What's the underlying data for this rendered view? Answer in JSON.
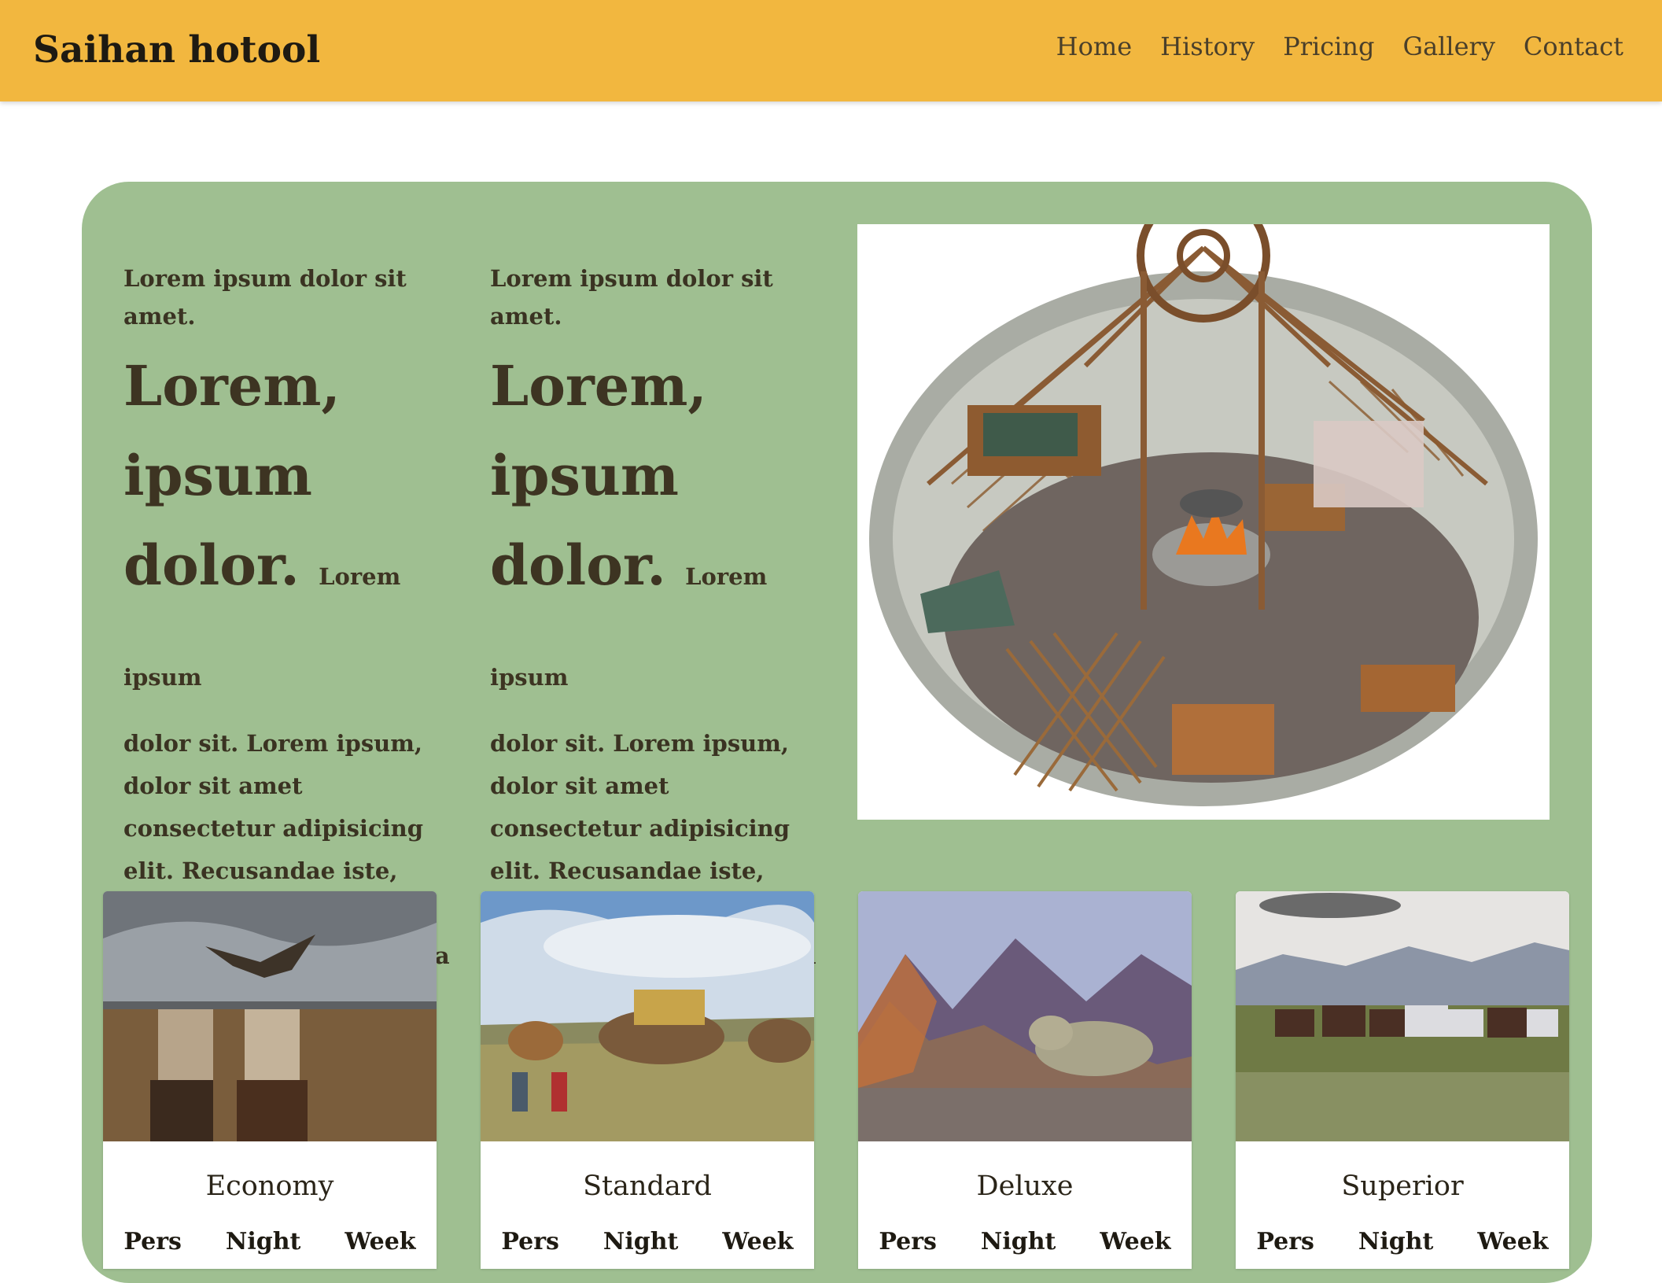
{
  "header": {
    "brand": "Saihan hotool",
    "nav": [
      "Home",
      "History",
      "Pricing",
      "Gallery",
      "Contact"
    ]
  },
  "intro": {
    "columns": [
      {
        "kicker": "Lorem ipsum dolor sit amet.",
        "headline": "Lorem, ipsum dolor.",
        "lead": "Lorem ipsum",
        "body": "dolor sit. Lorem ipsum, dolor sit amet consectetur adipisicing elit. Recusandae iste, aperiam tenetur rerum corporis delectus minima neque"
      },
      {
        "kicker": "Lorem ipsum dolor sit amet.",
        "headline": "Lorem, ipsum dolor.",
        "lead": "Lorem ipsum",
        "body": "dolor sit. Lorem ipsum, dolor sit amet consectetur adipisicing elit. Recusandae iste, aperiam tenetur rerum corporis delectus minima neque"
      }
    ]
  },
  "cards": [
    {
      "title": "Economy",
      "columns": [
        "Pers",
        "Night",
        "Week"
      ]
    },
    {
      "title": "Standard",
      "columns": [
        "Pers",
        "Night",
        "Week"
      ]
    },
    {
      "title": "Deluxe",
      "columns": [
        "Pers",
        "Night",
        "Week"
      ]
    },
    {
      "title": "Superior",
      "columns": [
        "Pers",
        "Night",
        "Week"
      ]
    }
  ],
  "colors": {
    "header": "#f2b73f",
    "panel": "#9fbf91",
    "text": "#3a3322"
  }
}
